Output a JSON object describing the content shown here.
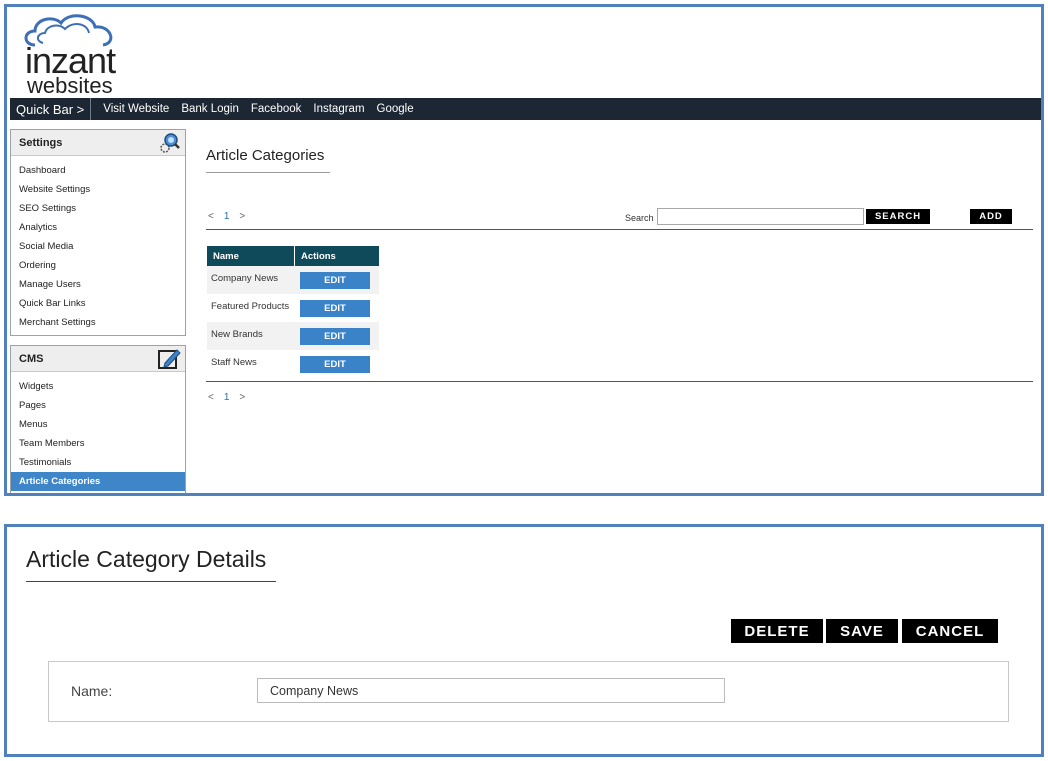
{
  "logo": {
    "line1": "inzant",
    "line2": "websites"
  },
  "quickbar": {
    "title": "Quick Bar >",
    "links": [
      "Visit Website",
      "Bank Login",
      "Facebook",
      "Instagram",
      "Google"
    ]
  },
  "sidebar": {
    "settings": {
      "title": "Settings",
      "items": [
        "Dashboard",
        "Website Settings",
        "SEO Settings",
        "Analytics",
        "Social Media",
        "Ordering",
        "Manage Users",
        "Quick Bar Links",
        "Merchant Settings"
      ]
    },
    "cms": {
      "title": "CMS",
      "items": [
        "Widgets",
        "Pages",
        "Menus",
        "Team Members",
        "Testimonials",
        "Article Categories"
      ],
      "active": "Article Categories"
    }
  },
  "main": {
    "title": "Article Categories",
    "pager": {
      "prev": "<",
      "page": "1",
      "next": ">"
    },
    "search_label": "Search",
    "search_value": "",
    "search_button": "SEARCH",
    "add_button": "ADD",
    "table": {
      "headers": [
        "Name",
        "Actions"
      ],
      "rows": [
        {
          "name": "Company News",
          "action": "EDIT"
        },
        {
          "name": "Featured Products",
          "action": "EDIT"
        },
        {
          "name": "New Brands",
          "action": "EDIT"
        },
        {
          "name": "Staff News",
          "action": "EDIT"
        }
      ]
    }
  },
  "details": {
    "title": "Article Category Details",
    "buttons": {
      "delete": "DELETE",
      "save": "SAVE",
      "cancel": "CANCEL"
    },
    "name_label": "Name:",
    "name_value": "Company News"
  },
  "colors": {
    "panel_border": "#4f81bd",
    "quickbar_bg": "#1c2733",
    "table_header": "#0f4a5a",
    "edit_button": "#3a83c9",
    "active_item": "#3f86c8"
  }
}
